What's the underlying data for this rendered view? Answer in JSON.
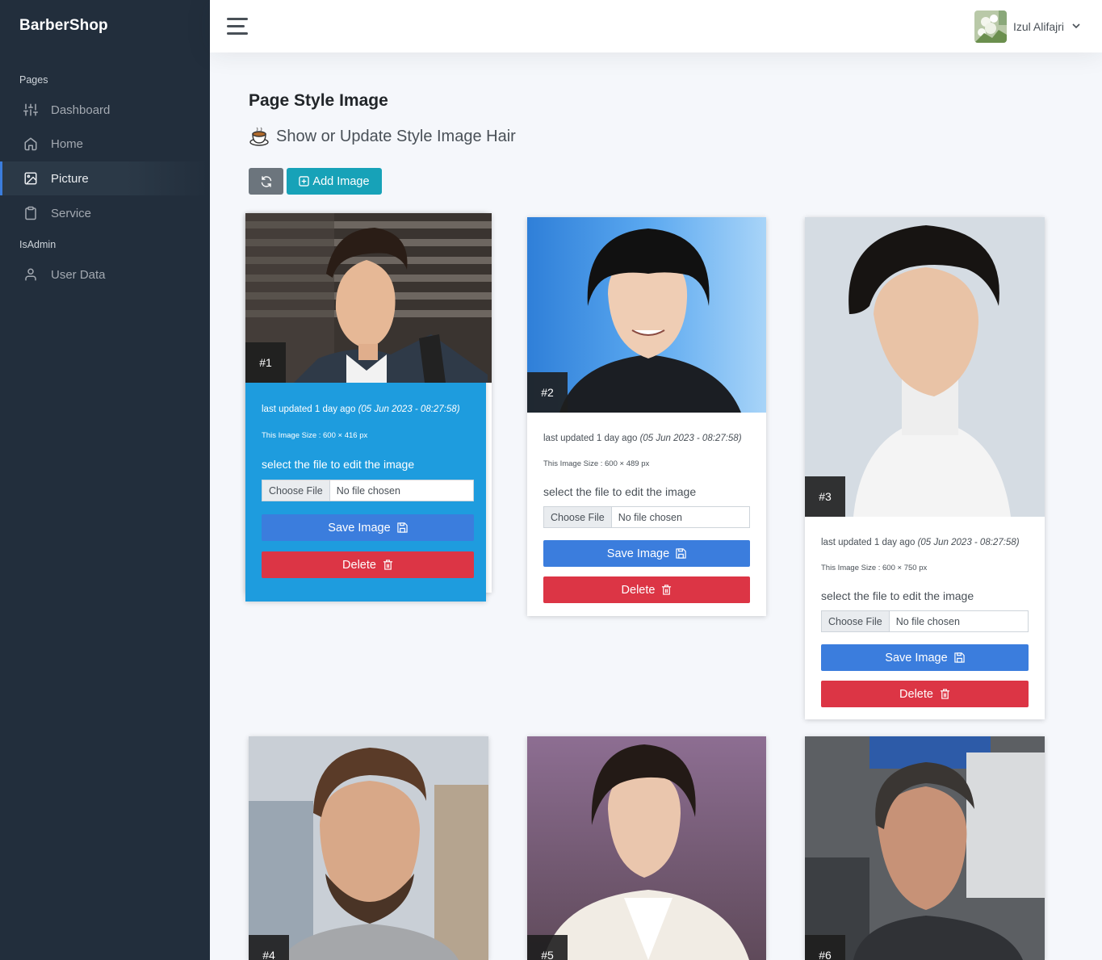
{
  "sidebar": {
    "brand": "BarberShop",
    "section_pages": "Pages",
    "section_admin": "IsAdmin",
    "items": [
      {
        "label": "Dashboard",
        "icon": "sliders-icon"
      },
      {
        "label": "Home",
        "icon": "home-icon"
      },
      {
        "label": "Picture",
        "icon": "image-icon",
        "active": true
      },
      {
        "label": "Service",
        "icon": "clipboard-icon"
      },
      {
        "label": "User Data",
        "icon": "user-icon"
      }
    ]
  },
  "topbar": {
    "user_name": "Izul Alifajri"
  },
  "header": {
    "title_bold": "Page",
    "title_rest": " Style Image",
    "subtitle": "Show or Update Style Image Hair"
  },
  "toolbar": {
    "add_label": "Add Image"
  },
  "cards": [
    {
      "num": "#1",
      "updated": "last updated 1 day ago",
      "date": "(05 Jun 2023 - 08:27:58)",
      "size": "This Image Size : 600 × 416 px",
      "select": "select the file to edit the image",
      "choose": "Choose File",
      "no_file": "No file chosen",
      "save": "Save Image",
      "delete": "Delete"
    },
    {
      "num": "#2",
      "updated": "last updated 1 day ago",
      "date": "(05 Jun 2023 - 08:27:58)",
      "size": "This Image Size : 600 × 489 px",
      "select": "select the file to edit the image",
      "choose": "Choose File",
      "no_file": "No file chosen",
      "save": "Save Image",
      "delete": "Delete"
    },
    {
      "num": "#3",
      "updated": "last updated 1 day ago",
      "date": "(05 Jun 2023 - 08:27:58)",
      "size": "This Image Size : 600 × 750 px",
      "select": "select the file to edit the image",
      "choose": "Choose File",
      "no_file": "No file chosen",
      "save": "Save Image",
      "delete": "Delete"
    },
    {
      "num": "#4"
    },
    {
      "num": "#5"
    },
    {
      "num": "#6"
    }
  ],
  "colors": {
    "sidebar_bg": "#222e3c",
    "primary": "#3b7ddd",
    "danger": "#dc3545",
    "info": "#17a2b8",
    "secondary": "#6c757d",
    "active_card": "#1e9cde"
  }
}
